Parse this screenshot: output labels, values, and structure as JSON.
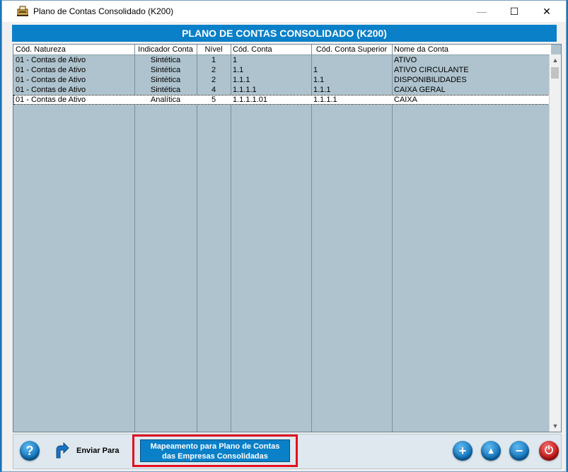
{
  "window": {
    "title": "Plano de Contas Consolidado (K200)",
    "controls": {
      "minimize": "—",
      "maximize": "☐",
      "close": "✕"
    }
  },
  "header": {
    "title": "PLANO DE CONTAS CONSOLIDADO (K200)"
  },
  "table": {
    "columns": [
      "Cód. Natureza",
      "Indicador Conta",
      "Nível",
      "Cód. Conta",
      "Cód. Conta Superior",
      "Nome da Conta"
    ],
    "rows": [
      [
        "01 - Contas de Ativo",
        "Sintética",
        "1",
        "1",
        "",
        "ATIVO"
      ],
      [
        "01 - Contas de Ativo",
        "Sintética",
        "2",
        "1.1",
        "1",
        "ATIVO CIRCULANTE"
      ],
      [
        "01 - Contas de Ativo",
        "Sintética",
        "2",
        "1.1.1",
        "1.1",
        "DISPONIBILIDADES"
      ],
      [
        "01 - Contas de Ativo",
        "Sintética",
        "4",
        "1.1.1.1",
        "1.1.1",
        "CAIXA GERAL"
      ],
      [
        "01 - Contas de Ativo",
        "Analítica",
        "5",
        "1.1.1.1.01",
        "1.1.1.1",
        "CAIXA"
      ]
    ],
    "selected_row": 4
  },
  "footer": {
    "help_label": "?",
    "send_label": "Enviar Para",
    "map_button_line1": "Mapeamento para Plano de Contas",
    "map_button_line2": "das Empresas Consolidadas",
    "add_label": "+",
    "up_label": "▲",
    "remove_label": "−",
    "power_label": "⏻"
  },
  "colors": {
    "accent": "#0a80c8",
    "grid_bg": "#aec3ce",
    "highlight_frame": "#e01020",
    "power": "#c01010"
  }
}
